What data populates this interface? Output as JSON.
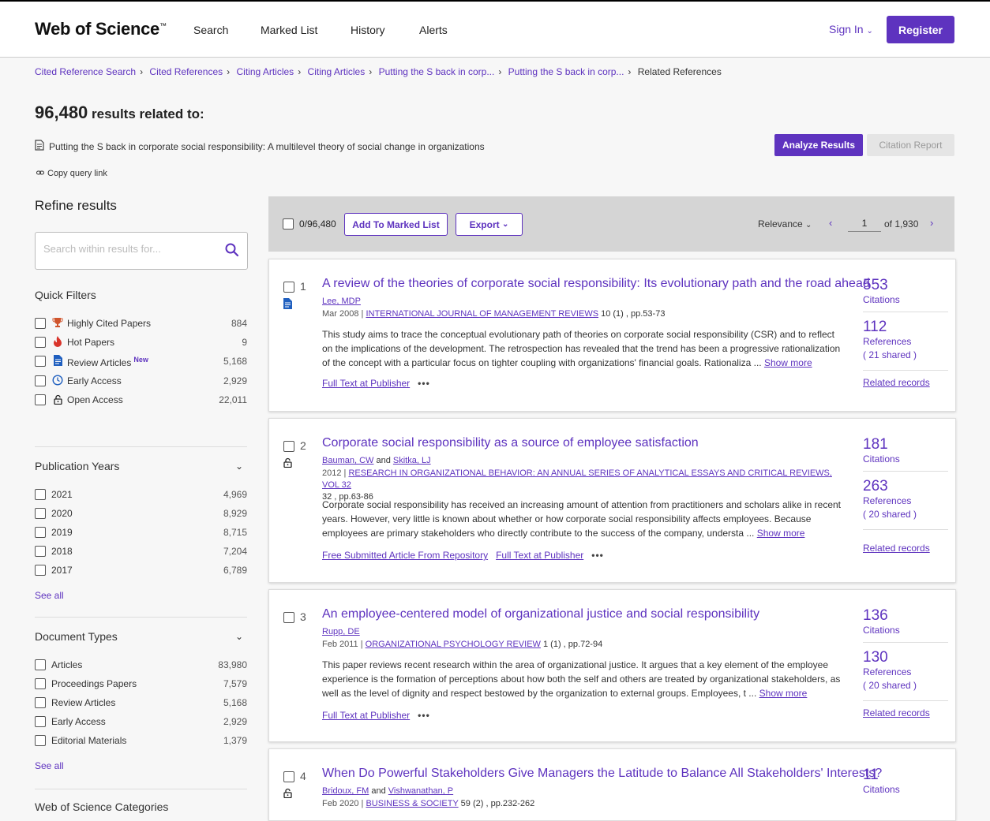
{
  "header": {
    "logo": "Web of Science",
    "logo_tm": "™",
    "nav": [
      "Search",
      "Marked List",
      "History",
      "Alerts"
    ],
    "sign_in": "Sign In",
    "register": "Register"
  },
  "breadcrumbs": [
    "Cited Reference Search",
    "Cited References",
    "Citing Articles",
    "Citing Articles",
    "Putting the S back in corp...",
    "Putting the S back in corp...",
    "Related References"
  ],
  "results": {
    "count": "96,480",
    "label": "results related to:",
    "query": "Putting the S back in corporate social responsibility: A multilevel theory of social change in organizations",
    "copy_link": "Copy query link",
    "analyze": "Analyze Results",
    "citation_report": "Citation Report"
  },
  "refine": {
    "title": "Refine results",
    "search_placeholder": "Search within results for...",
    "quick_filters_title": "Quick Filters",
    "quick_filters": [
      {
        "label": "Highly Cited Papers",
        "count": "884",
        "icon": "trophy-icon"
      },
      {
        "label": "Hot Papers",
        "count": "9",
        "icon": "flame-icon"
      },
      {
        "label": "Review Articles",
        "count": "5,168",
        "icon": "document-icon",
        "badge": "New"
      },
      {
        "label": "Early Access",
        "count": "2,929",
        "icon": "clock-icon"
      },
      {
        "label": "Open Access",
        "count": "22,011",
        "icon": "lock-icon"
      }
    ],
    "pub_years_title": "Publication Years",
    "pub_years": [
      {
        "label": "2021",
        "count": "4,969"
      },
      {
        "label": "2020",
        "count": "8,929"
      },
      {
        "label": "2019",
        "count": "8,715"
      },
      {
        "label": "2018",
        "count": "7,204"
      },
      {
        "label": "2017",
        "count": "6,789"
      }
    ],
    "doc_types_title": "Document Types",
    "doc_types": [
      {
        "label": "Articles",
        "count": "83,980"
      },
      {
        "label": "Proceedings Papers",
        "count": "7,579"
      },
      {
        "label": "Review Articles",
        "count": "5,168"
      },
      {
        "label": "Early Access",
        "count": "2,929"
      },
      {
        "label": "Editorial Materials",
        "count": "1,379"
      }
    ],
    "see_all": "See all",
    "categories_title": "Web of Science Categories"
  },
  "toolbar": {
    "selected": "0/96,480",
    "add_marked": "Add To Marked List",
    "export": "Export",
    "sort": "Relevance",
    "page": "1",
    "of_pages": "of 1,930"
  },
  "records": [
    {
      "num": "1",
      "title": "A review of the theories of corporate social responsibility: Its evolutionary path and the road ahead",
      "authors": [
        "Lee, MDP"
      ],
      "meta_prefix": "Mar 2008 | ",
      "journal": "INTERNATIONAL JOURNAL OF MANAGEMENT REVIEWS",
      "meta_suffix": " 10 (1) , pp.53-73",
      "abstract": "This study aims to trace the conceptual evolutionary path of theories on corporate social responsibility (CSR) and to reflect on the implications of the development. The retrospection has revealed that the trend has been a progressive rationalization of the concept with a particular focus on tighter coupling with organizations' financial goals. Rationaliza ...",
      "show_more": "Show more",
      "links": [
        "Full Text at Publisher"
      ],
      "citations": "553",
      "citations_label": "Citations",
      "references": "112",
      "references_label": "References",
      "shared": "( 21 shared )",
      "related": "Related records"
    },
    {
      "num": "2",
      "title": "Corporate social responsibility as a source of employee satisfaction",
      "authors": [
        "Bauman, CW",
        "Skitka, LJ"
      ],
      "meta_prefix": "2012 | ",
      "journal": "RESEARCH IN ORGANIZATIONAL BEHAVIOR: AN ANNUAL SERIES OF ANALYTICAL ESSAYS AND CRITICAL REVIEWS, VOL 32",
      "meta_suffix": " 32 , pp.63-86",
      "abstract": "Corporate social responsibility has received an increasing amount of attention from practitioners and scholars alike in recent years. However, very little is known about whether or how corporate social responsibility affects employees. Because employees are primary stakeholders who directly contribute to the success of the company, understa ...",
      "show_more": "Show more",
      "links": [
        "Free Submitted Article From Repository",
        "Full Text at Publisher"
      ],
      "citations": "181",
      "citations_label": "Citations",
      "references": "263",
      "references_label": "References",
      "shared": "( 20 shared )",
      "related": "Related records"
    },
    {
      "num": "3",
      "title": "An employee-centered model of organizational justice and social responsibility",
      "authors": [
        "Rupp, DE"
      ],
      "meta_prefix": "Feb 2011 | ",
      "journal": "ORGANIZATIONAL PSYCHOLOGY REVIEW",
      "meta_suffix": " 1 (1) , pp.72-94",
      "abstract": "This paper reviews recent research within the area of organizational justice. It argues that a key element of the employee experience is the formation of perceptions about how both the self and others are treated by organizational stakeholders, as well as the level of dignity and respect bestowed by the organization to external groups. Employees, t ...",
      "show_more": "Show more",
      "links": [
        "Full Text at Publisher"
      ],
      "citations": "136",
      "citations_label": "Citations",
      "references": "130",
      "references_label": "References",
      "shared": "( 20 shared )",
      "related": "Related records"
    },
    {
      "num": "4",
      "title": "When Do Powerful Stakeholders Give Managers the Latitude to Balance All Stakeholders' Interests?",
      "authors": [
        "Bridoux, FM",
        "Vishwanathan, P"
      ],
      "meta_prefix": "Feb 2020 | ",
      "journal": "BUSINESS & SOCIETY",
      "meta_suffix": " 59 (2) , pp.232-262",
      "citations": "11",
      "citations_label": "Citations"
    }
  ],
  "and_word": "and",
  "colors": {
    "accent": "#5e33bf",
    "toolbar_bg": "#d5d5d5"
  }
}
